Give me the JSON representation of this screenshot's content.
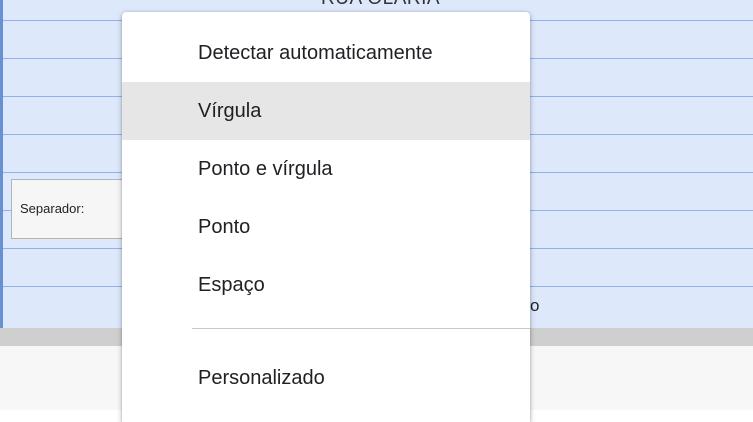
{
  "sheet": {
    "top_text": "RUA OLARIA",
    "tail_text": "o"
  },
  "separator": {
    "label": "Separador:"
  },
  "menu": {
    "items": [
      {
        "label": "Detectar automaticamente"
      },
      {
        "label": "Vírgula",
        "highlighted": true
      },
      {
        "label": "Ponto e vírgula"
      },
      {
        "label": "Ponto"
      },
      {
        "label": "Espaço"
      },
      {
        "label": "Personalizado"
      }
    ]
  },
  "colors": {
    "sheet_bg": "#dde8fb",
    "sheet_border": "#6d8fc7",
    "menu_highlight": "#e6e6e6",
    "menu_text": "#202124"
  }
}
